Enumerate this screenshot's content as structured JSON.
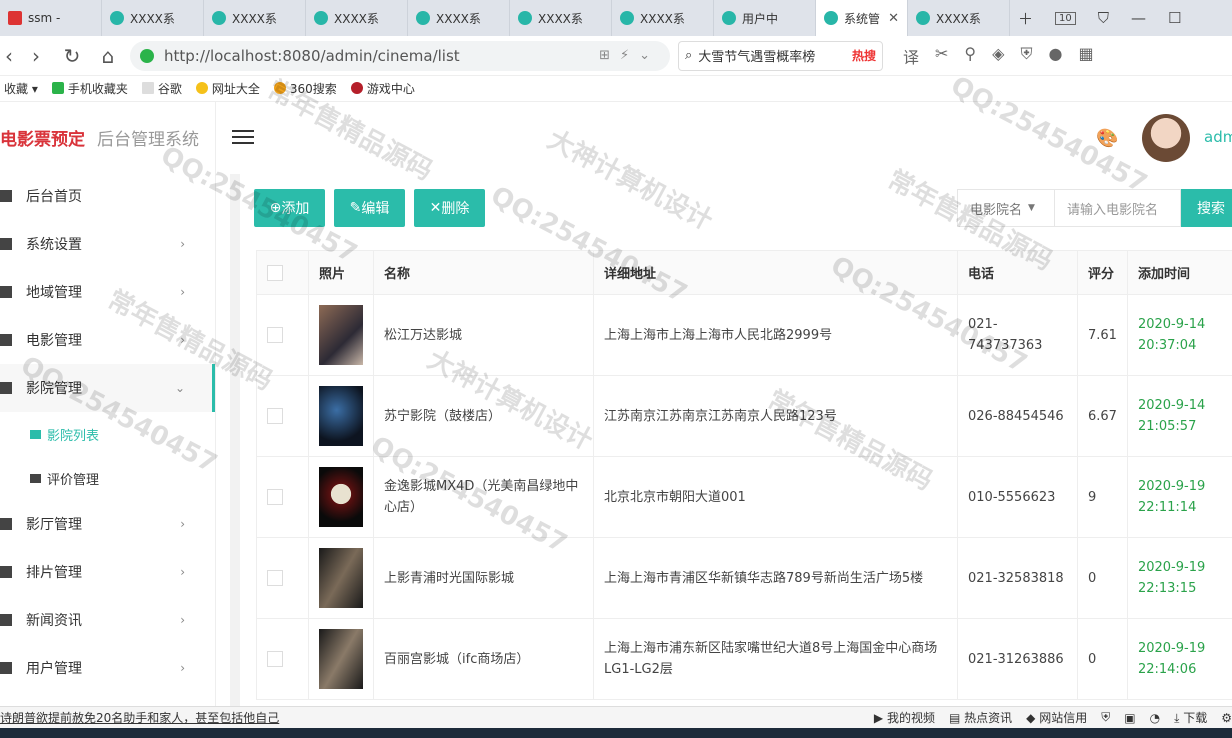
{
  "browser": {
    "tabs": [
      {
        "label": "ssm -",
        "active": false
      },
      {
        "label": "XXXX系",
        "active": false
      },
      {
        "label": "XXXX系",
        "active": false
      },
      {
        "label": "XXXX系",
        "active": false
      },
      {
        "label": "XXXX系",
        "active": false
      },
      {
        "label": "XXXX系",
        "active": false
      },
      {
        "label": "XXXX系",
        "active": false
      },
      {
        "label": "用户中",
        "active": false
      },
      {
        "label": "系统管",
        "active": true
      },
      {
        "label": "XXXX系",
        "active": false
      }
    ],
    "tab_count": "10",
    "url": "http://localhost:8080/admin/cinema/list",
    "search_text": "大雪节气遇雪概率榜",
    "search_hot": "热搜",
    "bookmarks": [
      "收藏",
      "手机收藏夹",
      "谷歌",
      "网址大全",
      "360搜索",
      "游戏中心"
    ]
  },
  "app": {
    "brand": "电影票预定",
    "subtitle": "后台管理系统",
    "user_name": "admin",
    "accent_color": "#2bbcaa"
  },
  "sidebar": {
    "items": [
      {
        "label": "后台首页",
        "icon": "home-icon",
        "has_arrow": false
      },
      {
        "label": "系统设置",
        "icon": "gear-icon",
        "has_arrow": true
      },
      {
        "label": "地域管理",
        "icon": "map-icon",
        "has_arrow": true
      },
      {
        "label": "电影管理",
        "icon": "film-icon",
        "has_arrow": true
      },
      {
        "label": "影院管理",
        "icon": "cinema-icon",
        "has_arrow": true,
        "open": true
      }
    ],
    "sub_items": [
      {
        "label": "影院列表",
        "active": true
      },
      {
        "label": "评价管理",
        "active": false
      }
    ],
    "items2": [
      {
        "label": "影厅管理",
        "has_arrow": true
      },
      {
        "label": "排片管理",
        "has_arrow": true
      },
      {
        "label": "新闻资讯",
        "has_arrow": true
      },
      {
        "label": "用户管理",
        "has_arrow": true
      }
    ]
  },
  "toolbar": {
    "add_label": "添加",
    "edit_label": "编辑",
    "delete_label": "删除",
    "filter_field": "电影院名",
    "filter_placeholder": "请输入电影院名",
    "search_label": "搜索"
  },
  "table": {
    "headers": [
      "",
      "照片",
      "名称",
      "详细地址",
      "电话",
      "评分",
      "添加时间"
    ],
    "rows": [
      {
        "name": "松江万达影城",
        "address": "上海上海市上海上海市人民北路2999号",
        "phone": "021-743737363",
        "score": "7.61",
        "date": "2020-9-14",
        "time": "20:37:04"
      },
      {
        "name": "苏宁影院（鼓楼店）",
        "address": "江苏南京江苏南京江苏南京人民路123号",
        "phone": "026-88454546",
        "score": "6.67",
        "date": "2020-9-14",
        "time": "21:05:57"
      },
      {
        "name": "金逸影城MX4D（光美南昌绿地中心店）",
        "address": "北京北京市朝阳大道001",
        "phone": "010-5556623",
        "score": "9",
        "date": "2020-9-19",
        "time": "22:11:14"
      },
      {
        "name": "上影青浦时光国际影城",
        "address": "上海上海市青浦区华新镇华志路789号新尚生活广场5楼",
        "phone": "021-32583818",
        "score": "0",
        "date": "2020-9-19",
        "time": "22:13:15"
      },
      {
        "name": "百丽宫影城（ifc商场店）",
        "address": "上海上海市浦东新区陆家嘴世纪大道8号上海国金中心商场LG1-LG2层",
        "phone": "021-31263886",
        "score": "0",
        "date": "2020-9-19",
        "time": "22:14:06"
      }
    ]
  },
  "statusbar": {
    "left_text": "诗朗普欲提前赦免20名助手和家人，甚至包括他自己",
    "right_items": [
      "我的视频",
      "热点资讯",
      "网站信用",
      "下载"
    ]
  },
  "watermarks": [
    "QQ:254540457",
    "大神计算机设计",
    "常年售精品源码"
  ]
}
